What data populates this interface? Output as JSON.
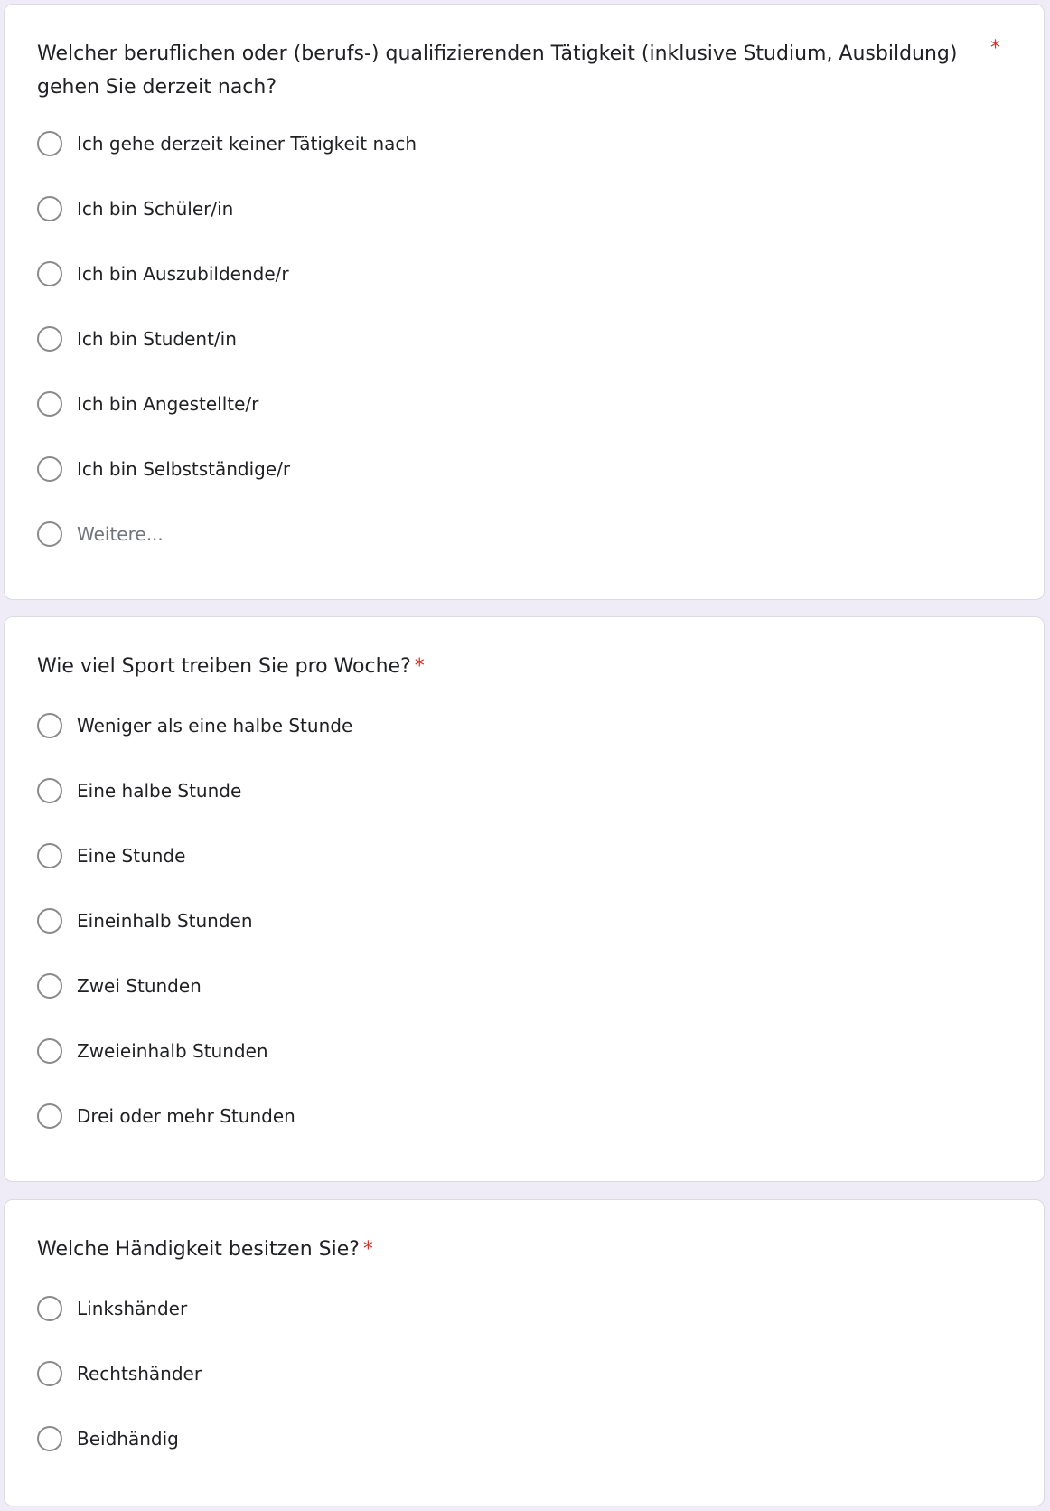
{
  "required_marker": "*",
  "questions": [
    {
      "title_line1": "Welcher beruflichen oder (berufs-) qualifizierenden Tätigkeit (inklusive Studium, Ausbildung)",
      "title_line2": "gehen Sie derzeit nach?",
      "options": [
        "Ich gehe derzeit keiner Tätigkeit nach",
        "Ich bin Schüler/in",
        "Ich bin Auszubildende/r",
        "Ich bin Student/in",
        "Ich bin Angestellte/r",
        "Ich bin Selbstständige/r"
      ],
      "other_placeholder": "Weitere..."
    },
    {
      "title": "Wie viel Sport treiben Sie pro Woche?",
      "options": [
        "Weniger als eine halbe Stunde",
        "Eine halbe Stunde",
        "Eine Stunde",
        "Eineinhalb Stunden",
        "Zwei Stunden",
        "Zweieinhalb Stunden",
        "Drei oder mehr Stunden"
      ]
    },
    {
      "title": "Welche Händigkeit besitzen Sie?",
      "options": [
        "Linkshänder",
        "Rechtshänder",
        "Beidhändig"
      ]
    }
  ]
}
